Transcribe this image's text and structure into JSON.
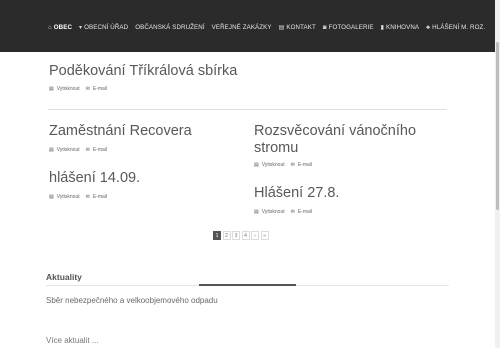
{
  "nav": {
    "items": [
      {
        "label": "OBEC",
        "icon": "home-icon",
        "glyph": "⌂"
      },
      {
        "label": "OBECNÍ ÚŘAD",
        "icon": "caret-down-icon",
        "glyph": "▾"
      },
      {
        "label": "OBČANSKÁ SDRUŽENÍ",
        "icon": "",
        "glyph": ""
      },
      {
        "label": "VEŘEJNÉ ZAKÁZKY",
        "icon": "",
        "glyph": ""
      },
      {
        "label": "KONTAKT",
        "icon": "contact-card-icon",
        "glyph": "▤"
      },
      {
        "label": "FOTOGALERIE",
        "icon": "camera-icon",
        "glyph": "◙"
      },
      {
        "label": "KNIHOVNA",
        "icon": "book-icon",
        "glyph": "▮"
      },
      {
        "label": "HLÁŠENÍ M. ROZ.",
        "icon": "bell-icon",
        "glyph": "♣"
      }
    ]
  },
  "actions": {
    "print_label": "Vytisknout",
    "email_label": "E-mail",
    "print_icon": "print-icon",
    "email_icon": "email-icon"
  },
  "articles": [
    {
      "title": "Poděkování Tříkrálová sbírka"
    },
    {
      "title": "Zaměstnání Recovera"
    },
    {
      "title": "Rozsvěcování vánočního stromu"
    },
    {
      "title": "hlášení 14.09."
    },
    {
      "title": "Hlášení 27.8."
    }
  ],
  "pagination": {
    "pages": [
      "1",
      "2",
      "3",
      "4",
      "›",
      "»"
    ],
    "current": "1"
  },
  "news": {
    "heading": "Aktuality",
    "items": [
      "Sběr nebezpečného a velkoobjemového odpadu"
    ],
    "more_label": "Více aktualit ..."
  },
  "colors": {
    "navbar_bg": "#2b2b2b",
    "accent": "#555555"
  }
}
